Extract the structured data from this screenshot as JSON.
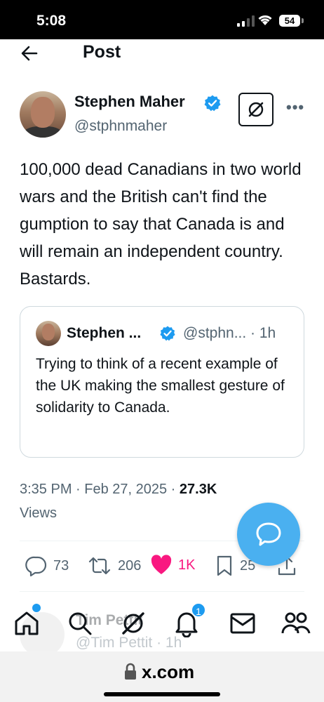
{
  "status_bar": {
    "time": "5:08",
    "battery": "54"
  },
  "header": {
    "title": "Post"
  },
  "post": {
    "author_name": "Stephen Maher",
    "author_handle": "@stphnmaher",
    "text": "100,000 dead Canadians in two world wars and the British can't find the gumption to say that Canada is and will remain an independent country. Bastards.",
    "timestamp": "3:35 PM · Feb 27, 2025 · ",
    "views_count": "27.3K",
    "views_label": "Views"
  },
  "quote": {
    "author_name": "Stephen ...",
    "author_handle": "@stphn...",
    "time": "· 1h",
    "text": "Trying to think of a recent example of the UK making the smallest gesture of solidarity to Canada."
  },
  "actions": {
    "replies": "73",
    "reposts": "206",
    "likes": "1K",
    "bookmarks": "25"
  },
  "reply_preview": {
    "author_name": "Tim Pettit",
    "author_handle": "@Tim Pettit",
    "time": "· 1h"
  },
  "tab_bar": {
    "items": [
      "home-icon",
      "search-icon",
      "grok-icon",
      "notifications-icon",
      "messages-icon",
      "communities-icon"
    ],
    "notification_count": "1"
  },
  "url_bar": {
    "domain": "x.com"
  },
  "colors": {
    "accent": "#1d9bf0",
    "like": "#f91880",
    "fab": "#4ab0f0"
  }
}
